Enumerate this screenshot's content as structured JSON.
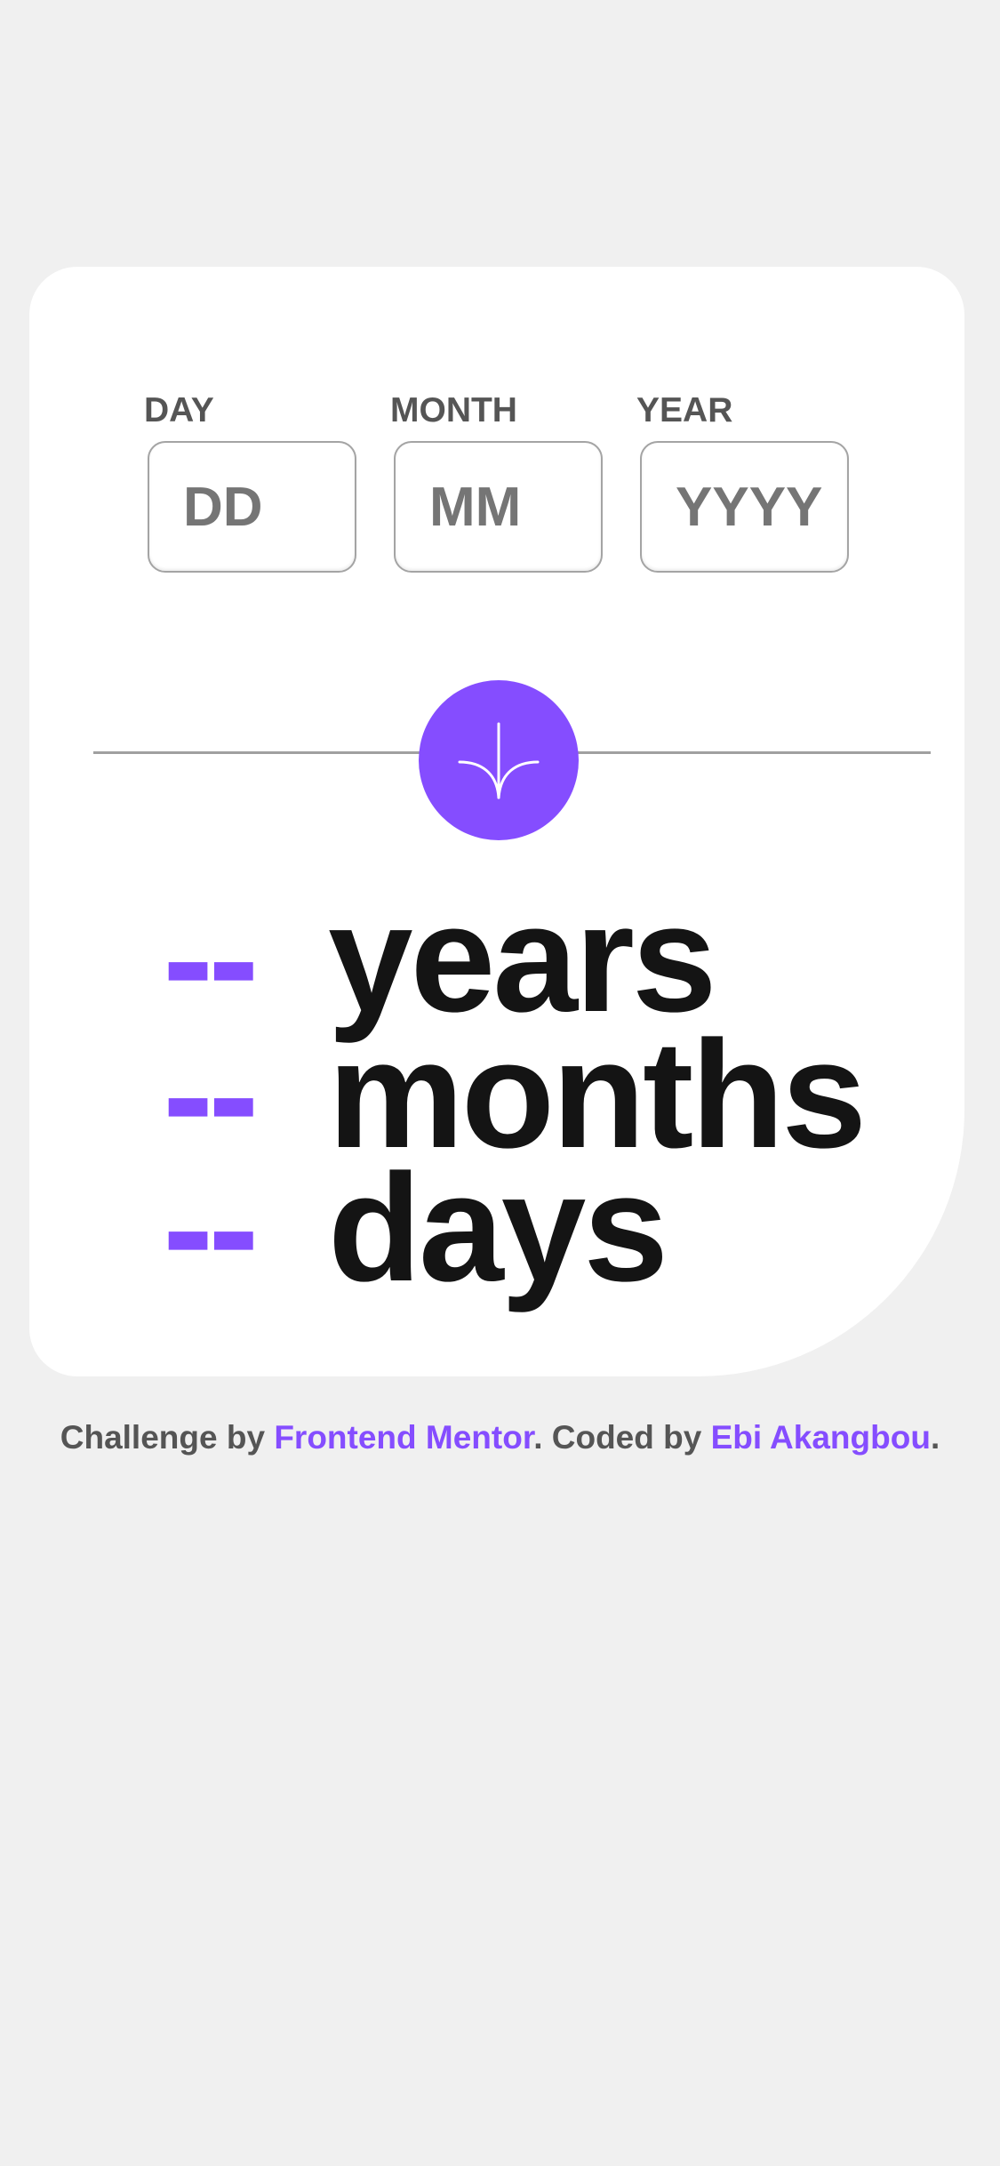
{
  "form": {
    "day": {
      "label": "DAY",
      "placeholder": "DD",
      "value": ""
    },
    "month": {
      "label": "MONTH",
      "placeholder": "MM",
      "value": ""
    },
    "year": {
      "label": "YEAR",
      "placeholder": "YYYY",
      "value": ""
    },
    "submit_icon": "arrow-down-icon"
  },
  "results": {
    "years": {
      "value": "--",
      "unit": "years"
    },
    "months": {
      "value": "--",
      "unit": "months"
    },
    "days": {
      "value": "--",
      "unit": "days"
    }
  },
  "attribution": {
    "prefix": "Challenge by ",
    "challenge_link": "Frontend Mentor",
    "middle": ". Coded by ",
    "author_link": "Ebi Akangbou",
    "suffix": "."
  },
  "colors": {
    "accent": "#854dff",
    "background": "#f0f0f0",
    "card": "#ffffff",
    "text_dark": "#141414",
    "text_grey": "#555555"
  }
}
